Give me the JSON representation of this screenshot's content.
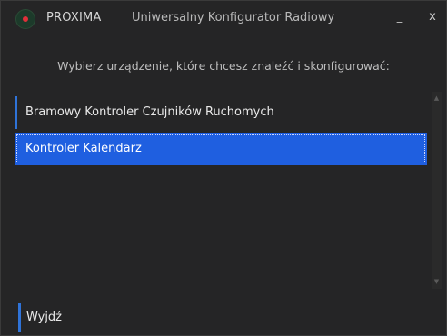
{
  "titlebar": {
    "brand": "PROXIMA",
    "title": "Uniwersalny Konfigurator Radiowy",
    "minimize_label": "_",
    "close_label": "x"
  },
  "prompt": "Wybierz urządzenie, które chcesz znaleźć i skonfigurować:",
  "devices": [
    {
      "label": "Bramowy Kontroler Czujników Ruchomych",
      "selected": false
    },
    {
      "label": "Kontroler Kalendarz",
      "selected": true
    }
  ],
  "footer": {
    "exit_label": "Wyjdź"
  },
  "colors": {
    "accent": "#1f5fe0",
    "background": "#252526",
    "logo_dot": "#e0303a"
  },
  "icons": {
    "logo": "proxima-logo-icon",
    "scroll_up": "triangle-up-icon",
    "scroll_down": "triangle-down-icon"
  }
}
